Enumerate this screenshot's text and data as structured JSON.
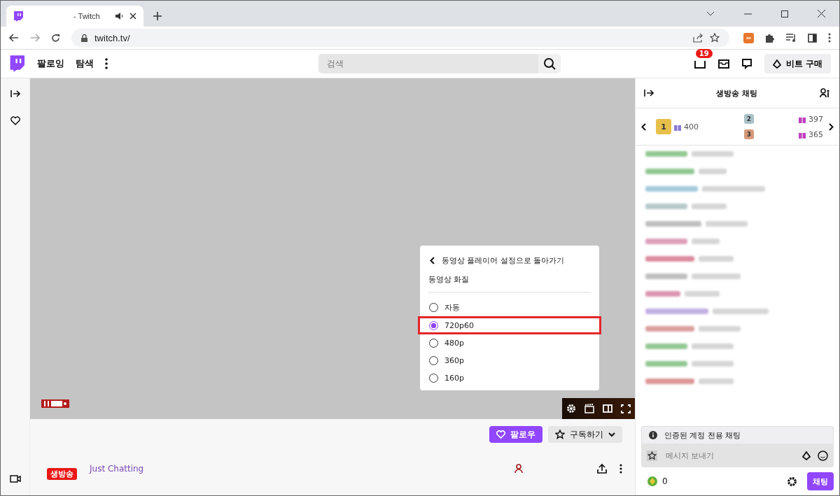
{
  "browser": {
    "tabs": [
      {
        "title": "- Twitch",
        "selected": true
      }
    ],
    "url": "twitch.tv/"
  },
  "nav": {
    "items": [
      "팔로잉",
      "탐색"
    ],
    "search": {
      "placeholder": "검색"
    },
    "notification_count": "19",
    "bits_button": "비트 구매"
  },
  "quality_menu": {
    "back": "동영상 플레이어 설정으로 돌아가기",
    "title": "동영상 화질",
    "options": [
      {
        "label": "자동",
        "selected": false
      },
      {
        "label": "720p60",
        "selected": true
      },
      {
        "label": "480p",
        "selected": false
      },
      {
        "label": "360p",
        "selected": false
      },
      {
        "label": "160p",
        "selected": false
      }
    ]
  },
  "channel": {
    "follow": "팔로우",
    "subscribe": "구독하기",
    "live_badge": "생방송",
    "category": "Just Chatting"
  },
  "chat": {
    "title": "생방송 채팅",
    "leaderboard": [
      {
        "rank": "1",
        "count": "400"
      },
      {
        "rank": "2",
        "count": "397"
      },
      {
        "rank": "3",
        "count": "365"
      }
    ],
    "notice": "인증된 계정 전용 채팅",
    "input": {
      "placeholder": "메시지 보내기"
    },
    "points": "0",
    "send": "채팅"
  }
}
